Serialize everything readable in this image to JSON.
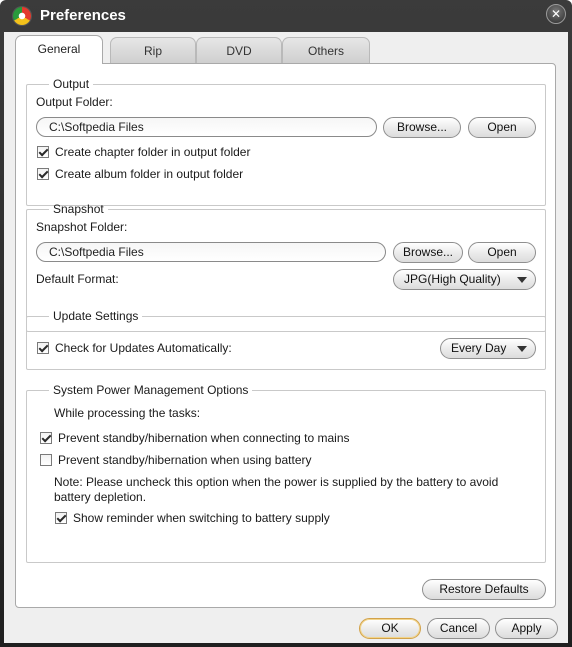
{
  "window": {
    "title": "Preferences"
  },
  "tabs": [
    "General",
    "Rip",
    "DVD",
    "Others"
  ],
  "output": {
    "legend": "Output",
    "folder_label": "Output Folder:",
    "folder_value": "C:\\Softpedia Files",
    "browse": "Browse...",
    "open": "Open",
    "chapter_checkbox": "Create chapter folder in output folder",
    "album_checkbox": "Create album folder in output folder"
  },
  "snapshot": {
    "legend": "Snapshot",
    "folder_label": "Snapshot Folder:",
    "folder_value": "C:\\Softpedia Files",
    "browse": "Browse...",
    "open": "Open",
    "format_label": "Default Format:",
    "format_value": "JPG(High Quality)"
  },
  "update": {
    "legend": "Update Settings",
    "check_label": "Check for Updates Automatically:",
    "frequency": "Every Day"
  },
  "power": {
    "legend": "System Power Management Options",
    "intro": "While processing the tasks:",
    "mains": "Prevent standby/hibernation when connecting to mains",
    "battery": "Prevent standby/hibernation when using battery",
    "note_line1": "Note: Please uncheck this option when the power is supplied by the battery to avoid",
    "note_line2": "battery depletion.",
    "reminder": "Show reminder when switching to battery supply"
  },
  "footer": {
    "restore": "Restore Defaults",
    "ok": "OK",
    "cancel": "Cancel",
    "apply": "Apply"
  },
  "checkbox_states": {
    "chapter": true,
    "album": true,
    "updates": true,
    "mains": true,
    "battery": false,
    "reminder": true
  },
  "icons": {
    "close": "close-icon",
    "app": "app-logo-icon",
    "dropdown": "chevron-down-icon"
  }
}
